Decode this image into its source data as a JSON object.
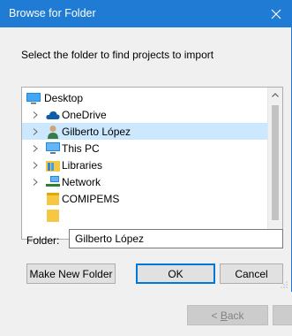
{
  "dialog": {
    "title": "Browse for Folder",
    "prompt": "Select the folder to find projects to import",
    "folder_label": "Folder:",
    "folder_value": "Gilberto López",
    "make_new_folder_label": "Make New Folder",
    "ok_label": "OK",
    "cancel_label": "Cancel"
  },
  "tree": {
    "items": [
      {
        "label": "Desktop",
        "icon": "desktop-icon"
      },
      {
        "label": "OneDrive",
        "icon": "onedrive-cloud-icon"
      },
      {
        "label": "Gilberto López",
        "icon": "user-folder-icon"
      },
      {
        "label": "This PC",
        "icon": "this-pc-icon"
      },
      {
        "label": "Libraries",
        "icon": "libraries-icon"
      },
      {
        "label": "Network",
        "icon": "network-icon"
      },
      {
        "label": "COMIPEMS",
        "icon": "folder-icon"
      }
    ]
  },
  "background_wizard": {
    "back_prefix": "< ",
    "back_mnemonic": "B",
    "back_rest": "ack"
  },
  "colors": {
    "titlebar": "#1f7bd3",
    "selection": "#cce8ff",
    "default_button_border": "#0078d7"
  }
}
